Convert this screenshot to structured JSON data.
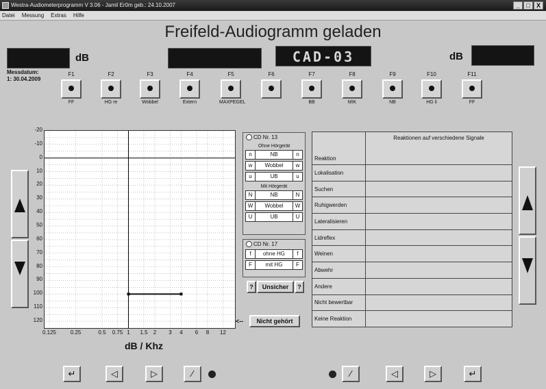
{
  "window": {
    "title": "Westra-Audiometerprogramm V 3.06 - Jamil Er0m  geb.: 24.10.2007",
    "controls": [
      "_",
      "□",
      "X"
    ]
  },
  "menu": [
    "Datei",
    "Messung",
    "Extras",
    "Hilfe"
  ],
  "main_title": "Freifeld-Audiogramm geladen",
  "displays": {
    "left_db_unit": "dB",
    "center_code": "CAD-03",
    "right_db_unit": "dB"
  },
  "messdatum": {
    "label": "Messdatum:",
    "value": "1: 30.04.2009"
  },
  "function_keys": [
    {
      "key": "F1",
      "sub": "FF"
    },
    {
      "key": "F2",
      "sub": "HG re"
    },
    {
      "key": "F3",
      "sub": "Wobbel"
    },
    {
      "key": "F4",
      "sub": "Extern"
    },
    {
      "key": "F5",
      "sub": "MAXPEGEL"
    },
    {
      "key": "F6",
      "sub": ""
    },
    {
      "key": "F7",
      "sub": "BB"
    },
    {
      "key": "F8",
      "sub": "MIK"
    },
    {
      "key": "F9",
      "sub": "NB"
    },
    {
      "key": "F10",
      "sub": "HG li"
    },
    {
      "key": "F11",
      "sub": "FF"
    }
  ],
  "chart_data": {
    "type": "line",
    "title": "",
    "xlabel": "dB / Khz",
    "ylabel": "",
    "x_scale": "log",
    "x_ticks": [
      "0.125",
      "0.25",
      "0.5",
      "0.75",
      "1",
      "1.5",
      "2",
      "3",
      "4",
      "6",
      "8",
      "12"
    ],
    "x_tick_values": [
      0.125,
      0.25,
      0.5,
      0.75,
      1,
      1.5,
      2,
      3,
      4,
      6,
      8,
      12
    ],
    "y_ticks": [
      -20,
      -10,
      0,
      10,
      20,
      30,
      40,
      50,
      60,
      70,
      80,
      90,
      100,
      110,
      120
    ],
    "ylim": [
      -20,
      125
    ],
    "y_inverted": true,
    "grid": true,
    "reference_line_y": 0,
    "series": [
      {
        "name": "",
        "x": [
          1,
          4
        ],
        "y": [
          100,
          100
        ]
      }
    ]
  },
  "cd13": {
    "label": "CD Nr. 13",
    "ohne_label": "Ohne Hörgerät",
    "ohne_rows": [
      [
        "n",
        "NB",
        "n"
      ],
      [
        "w",
        "Wobbel",
        "w"
      ],
      [
        "u",
        "UB",
        "u"
      ]
    ],
    "mit_label": "Mit Hörgerät",
    "mit_rows": [
      [
        "N",
        "NB",
        "N"
      ],
      [
        "W",
        "Wobbel",
        "W"
      ],
      [
        "U",
        "UB",
        "U"
      ]
    ]
  },
  "cd17": {
    "label": "CD Nr. 17",
    "rows": [
      [
        "f",
        "ohne HG",
        "f"
      ],
      [
        "F",
        "mit HG",
        "F"
      ]
    ]
  },
  "unsicher": {
    "q_left": "?",
    "label": "Unsicher",
    "q_right": "?"
  },
  "nicht_gehoert": {
    "arrow": "<--",
    "label": "Nicht gehört"
  },
  "reactions": {
    "header": "Reaktionen auf verschiedene Signale",
    "rows": [
      "Reaktion",
      "Lokalisation",
      "Suchen",
      "Ruhigwerden",
      "Lateralisieren",
      "Lidreflex",
      "Weinen",
      "Abwehr",
      "Andere",
      "Nicht bewertbar",
      "Keine Reaktion"
    ]
  },
  "nav": {
    "enter": "↵",
    "prev": "◁",
    "next": "▷",
    "cursor": "⁄"
  }
}
